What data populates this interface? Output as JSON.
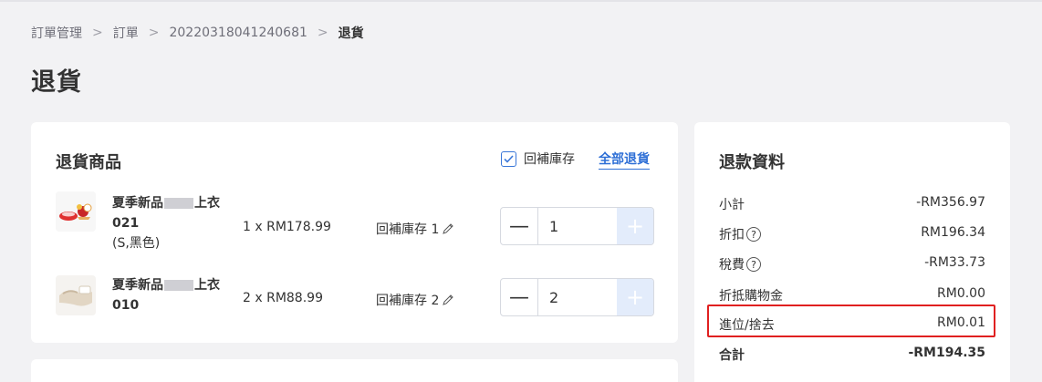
{
  "breadcrumb": {
    "items": [
      "訂單管理",
      "訂單",
      "20220318041240681"
    ],
    "current": "退貨",
    "separator": ">"
  },
  "page": {
    "title": "退貨"
  },
  "return_items": {
    "title": "退貨商品",
    "restock_all_label": "回補庫存",
    "restock_all_checked": true,
    "return_all_label": "全部退貨",
    "items": [
      {
        "name_prefix": "夏季新品",
        "name_suffix": "上衣",
        "name_line2": "021",
        "variant": "(S,黑色)",
        "qty_price": "1 x RM178.99",
        "restock_label": "回補庫存 1",
        "return_qty": "1",
        "minus": "—",
        "plus": "+"
      },
      {
        "name_prefix": "夏季新品",
        "name_suffix": "上衣",
        "name_line2": "010",
        "variant": "",
        "qty_price": "2 x RM88.99",
        "restock_label": "回補庫存 2",
        "return_qty": "2",
        "minus": "—",
        "plus": "+"
      }
    ]
  },
  "refund": {
    "title": "退款資料",
    "rows": [
      {
        "label": "小計",
        "value": "-RM356.97"
      },
      {
        "label": "折扣",
        "value": "RM196.34",
        "help": "?"
      },
      {
        "label": "稅費",
        "value": "-RM33.73",
        "help": "?"
      },
      {
        "label": "折抵購物金",
        "value": "RM0.00"
      },
      {
        "label": "進位/捨去",
        "value": "RM0.01"
      },
      {
        "label": "合計",
        "value": "-RM194.35"
      }
    ]
  },
  "colors": {
    "accent": "#2e6fd6",
    "highlight": "#e02020",
    "background": "#f2f2f4"
  }
}
